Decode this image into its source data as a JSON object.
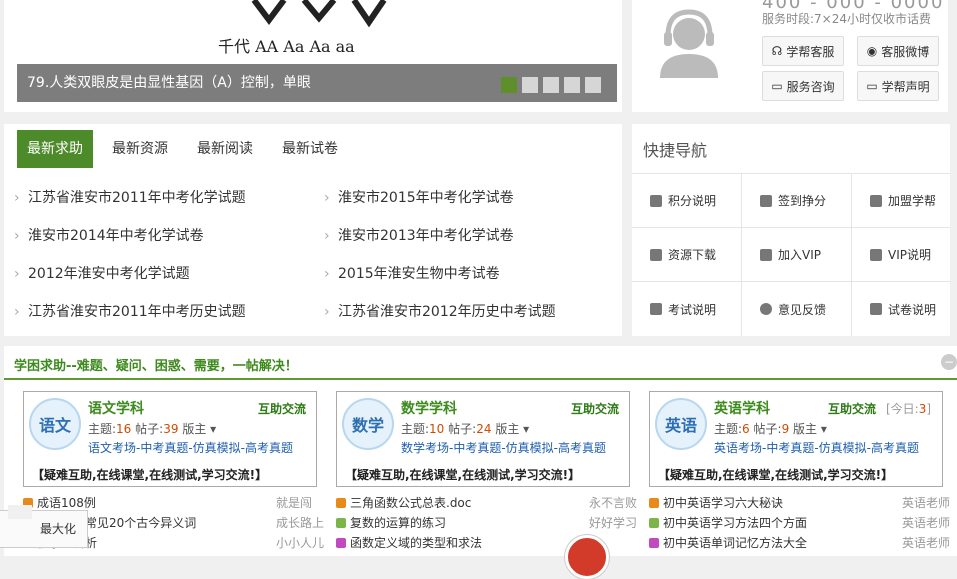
{
  "banner": {
    "caption": "79.人类双眼皮是由显性基因（A）控制，单眼",
    "art_text": "千代 AA Aa Aa aa",
    "dots": 5
  },
  "service": {
    "phone_partial": "400 - 000 - 0000",
    "hours": "服务时段:7×24小时仅收市话费",
    "buttons": [
      {
        "label": "学帮客服",
        "icon": "headset-icon"
      },
      {
        "label": "客服微博",
        "icon": "weibo-icon"
      },
      {
        "label": "服务咨询",
        "icon": "chat-icon"
      },
      {
        "label": "学帮声明",
        "icon": "chat-icon"
      }
    ]
  },
  "help": {
    "tabs": [
      "最新求助",
      "最新资源",
      "最新阅读",
      "最新试卷"
    ],
    "items": [
      "江苏省淮安市2011年中考化学试题",
      "淮安市2015年中考化学试卷",
      "淮安市2014年中考化学试卷",
      "淮安市2013年中考化学试卷",
      "2012年淮安中考化学试题",
      "2015年淮安生物中考试卷",
      "江苏省淮安市2011年中考历史试题",
      "江苏省淮安市2012年历史中考试题"
    ]
  },
  "quicknav": {
    "title": "快捷导航",
    "items": [
      {
        "label": "积分说明",
        "icon": "user-icon"
      },
      {
        "label": "签到挣分",
        "icon": "flag-icon"
      },
      {
        "label": "加盟学帮",
        "icon": "trophy-icon"
      },
      {
        "label": "资源下载",
        "icon": "download-icon"
      },
      {
        "label": "加入VIP",
        "icon": "question-icon"
      },
      {
        "label": "VIP说明",
        "icon": "android-icon"
      },
      {
        "label": "考试说明",
        "icon": "instagram-icon"
      },
      {
        "label": "意见反馈",
        "icon": "info-icon"
      },
      {
        "label": "试卷说明",
        "icon": "bookmark-icon"
      }
    ]
  },
  "forum": {
    "title": "学困求助--难题、疑问、困惑、需要，一帖解决！",
    "collapse_label": "−",
    "cards": [
      {
        "logo": "语文",
        "name": "语文学科",
        "tag": "互助交流",
        "topics_label": "主题:",
        "topics": "16",
        "posts_label": "帖子:",
        "posts": "39",
        "mod": "版主",
        "links": "语文考场-中考真题-仿真模拟-高考真题",
        "slogan": "【疑难互助,在线课堂,在线测试,学习交流!】",
        "today": ""
      },
      {
        "logo": "数学",
        "name": "数学学科",
        "tag": "互助交流",
        "topics_label": "主题:",
        "topics": "10",
        "posts_label": "帖子:",
        "posts": "24",
        "mod": "版主",
        "links": "数学考场-中考真题-仿真模拟-高考真题",
        "slogan": "【疑难互助,在线课堂,在线测试,学习交流!】",
        "today": ""
      },
      {
        "logo": "英语",
        "name": "英语学科",
        "tag": "互助交流",
        "topics_label": "主题:",
        "topics": "6",
        "posts_label": "帖子:",
        "posts": "9",
        "mod": "版主",
        "links": "英语考场-中考真题-仿真模拟-高考真题",
        "slogan": "【疑难互助,在线课堂,在线测试,学习交流!】",
        "today_label": "[今日:",
        "today": "3",
        "today_end": "]"
      }
    ],
    "posts": [
      [
        {
          "t": "成语108例",
          "a": "就是闯",
          "c": "#e88a1a"
        },
        {
          "t": "文言文中常见20个古今异义词",
          "a": "成长路上",
          "c": "#7bb54a"
        },
        {
          "t": "假字的辨析",
          "a": "小小人儿",
          "c": "#c04ac0"
        }
      ],
      [
        {
          "t": "三角函数公式总表.doc",
          "a": "永不言败",
          "c": "#e88a1a"
        },
        {
          "t": "复数的运算的练习",
          "a": "好好学习",
          "c": "#7bb54a"
        },
        {
          "t": "函数定义域的类型和求法",
          "a": "",
          "c": "#c04ac0"
        }
      ],
      [
        {
          "t": "初中英语学习六大秘诀",
          "a": "英语老师",
          "c": "#e88a1a"
        },
        {
          "t": "初中英语学习方法四个方面",
          "a": "英语老师",
          "c": "#7bb54a"
        },
        {
          "t": "初中英语单词记忆方法大全",
          "a": "英语老师",
          "c": "#c04ac0"
        }
      ]
    ]
  },
  "floatbar": {
    "label": "最大化"
  }
}
